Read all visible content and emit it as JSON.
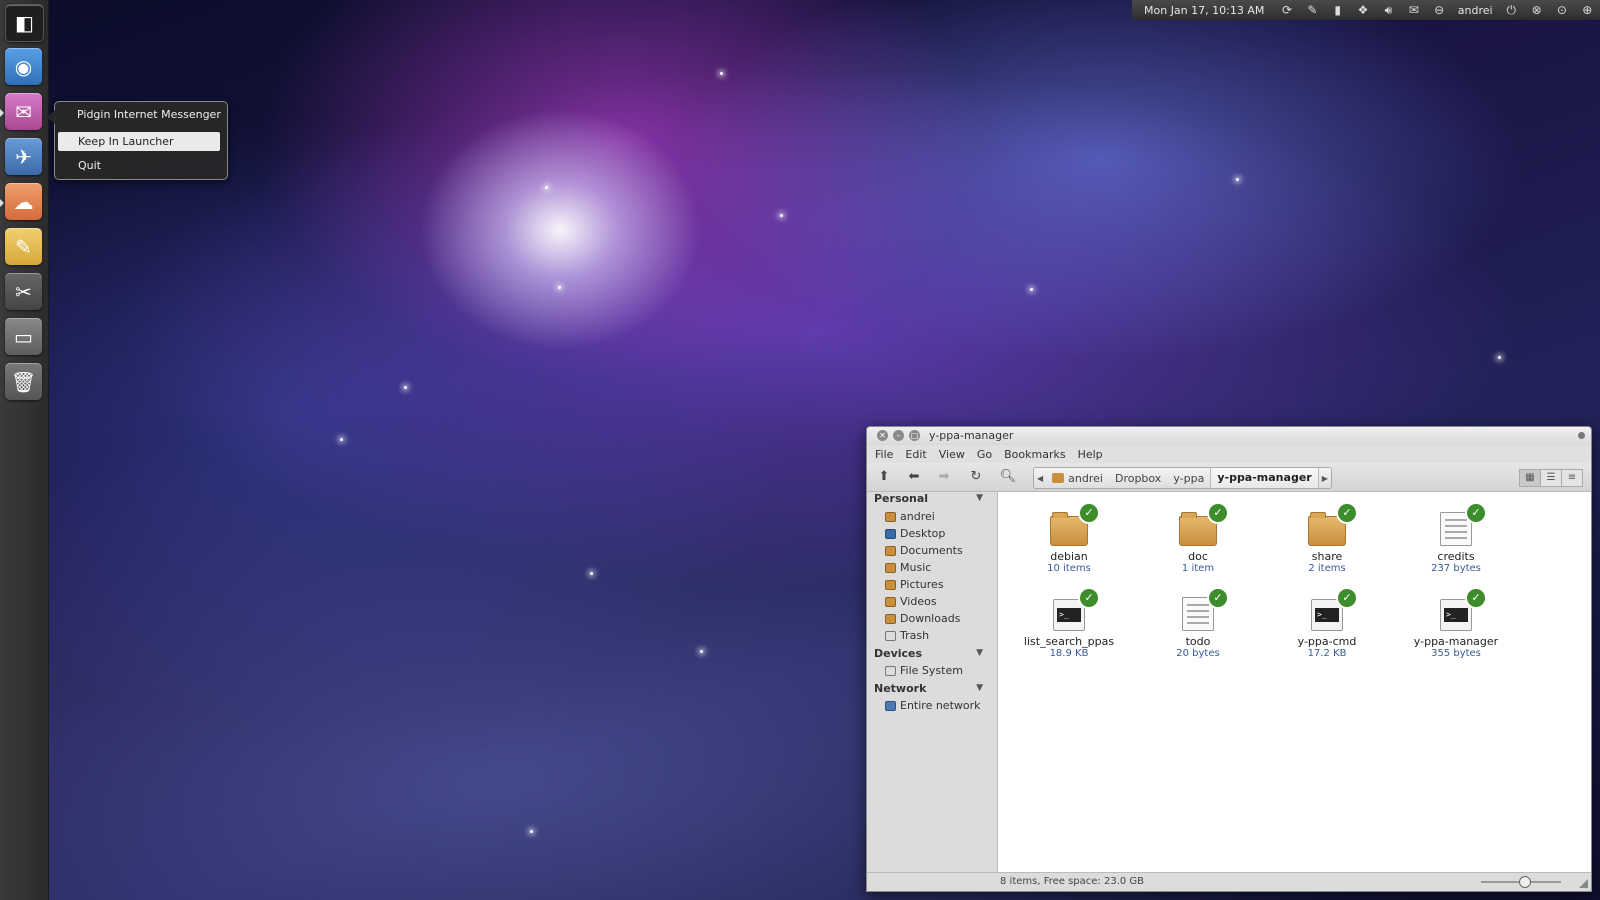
{
  "top_panel": {
    "clock": "Mon Jan 17, 10:13 AM",
    "user": "andrei",
    "indicator_icons": [
      "sync-icon",
      "pen-icon",
      "clipboard-icon",
      "dropbox-icon",
      "volume-icon",
      "mail-icon",
      "chat-icon",
      "power-icon",
      "close-circle-icon",
      "chevron-circle-icon",
      "chevron-up-circle-icon"
    ]
  },
  "launcher": {
    "icons": [
      "dash-icon",
      "screenshot-icon",
      "pidgin-icon",
      "thunderbird-icon",
      "ubuntu-one-icon",
      "text-editor-icon",
      "tools-icon",
      "files-icon",
      "trash-icon"
    ]
  },
  "quicklist": {
    "title": "Pidgin Internet Messenger",
    "items": [
      "Keep In Launcher",
      "Quit"
    ]
  },
  "window": {
    "title": "y-ppa-manager",
    "menu": [
      "File",
      "Edit",
      "View",
      "Go",
      "Bookmarks",
      "Help"
    ],
    "path": [
      "andrei",
      "Dropbox",
      "y-ppa",
      "y-ppa-manager"
    ],
    "sidebar": {
      "personal_header": "Personal",
      "personal": [
        "andrei",
        "Desktop",
        "Documents",
        "Music",
        "Pictures",
        "Videos",
        "Downloads",
        "Trash"
      ],
      "devices_header": "Devices",
      "devices": [
        "File System"
      ],
      "network_header": "Network",
      "network": [
        "Entire network"
      ]
    },
    "files": [
      {
        "name": "debian",
        "meta": "10 items",
        "type": "folder"
      },
      {
        "name": "doc",
        "meta": "1 item",
        "type": "folder"
      },
      {
        "name": "share",
        "meta": "2 items",
        "type": "folder"
      },
      {
        "name": "credits",
        "meta": "237 bytes",
        "type": "text"
      },
      {
        "name": "list_search_ppas",
        "meta": "18.9 KB",
        "type": "script"
      },
      {
        "name": "todo",
        "meta": "20 bytes",
        "type": "text"
      },
      {
        "name": "y-ppa-cmd",
        "meta": "17.2 KB",
        "type": "script"
      },
      {
        "name": "y-ppa-manager",
        "meta": "355 bytes",
        "type": "script"
      }
    ],
    "status": "8 items, Free space: 23.0 GB"
  }
}
